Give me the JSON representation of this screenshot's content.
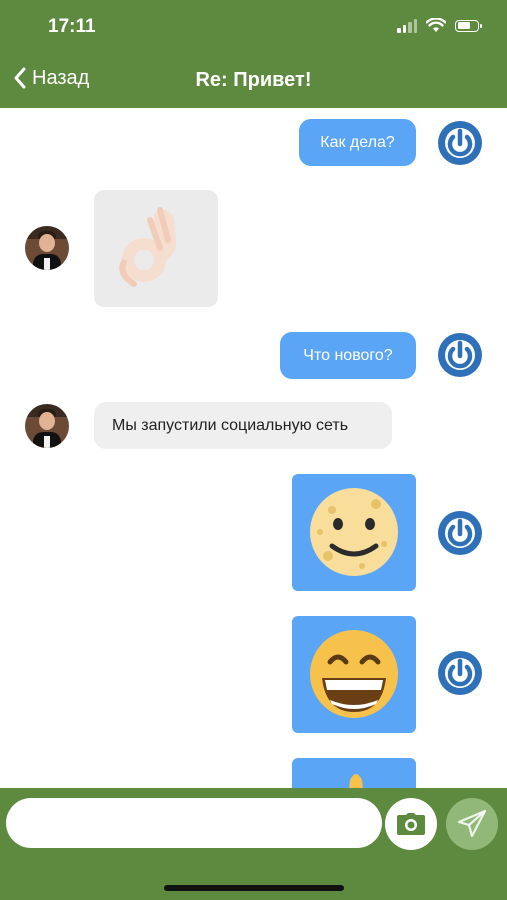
{
  "status": {
    "time": "17:11"
  },
  "header": {
    "back_label": "Назад",
    "title": "Re: Привет!"
  },
  "messages": [
    {
      "direction": "out",
      "type": "text",
      "text": "Как дела?"
    },
    {
      "direction": "in",
      "type": "sticker",
      "sticker": "ok-hand"
    },
    {
      "direction": "out",
      "type": "text",
      "text": "Что нового?"
    },
    {
      "direction": "in",
      "type": "text",
      "text": "Мы запустили социальную сеть"
    },
    {
      "direction": "out",
      "type": "sticker",
      "sticker": "moon-face"
    },
    {
      "direction": "out",
      "type": "sticker",
      "sticker": "grinning-face"
    },
    {
      "direction": "out",
      "type": "sticker",
      "sticker": "hand"
    }
  ],
  "composer": {
    "placeholder": ""
  },
  "colors": {
    "header": "#5e8a40",
    "outgoing_bubble": "#5aa5f5",
    "incoming_bubble": "#efefef",
    "power_avatar": "#2f71b8"
  }
}
